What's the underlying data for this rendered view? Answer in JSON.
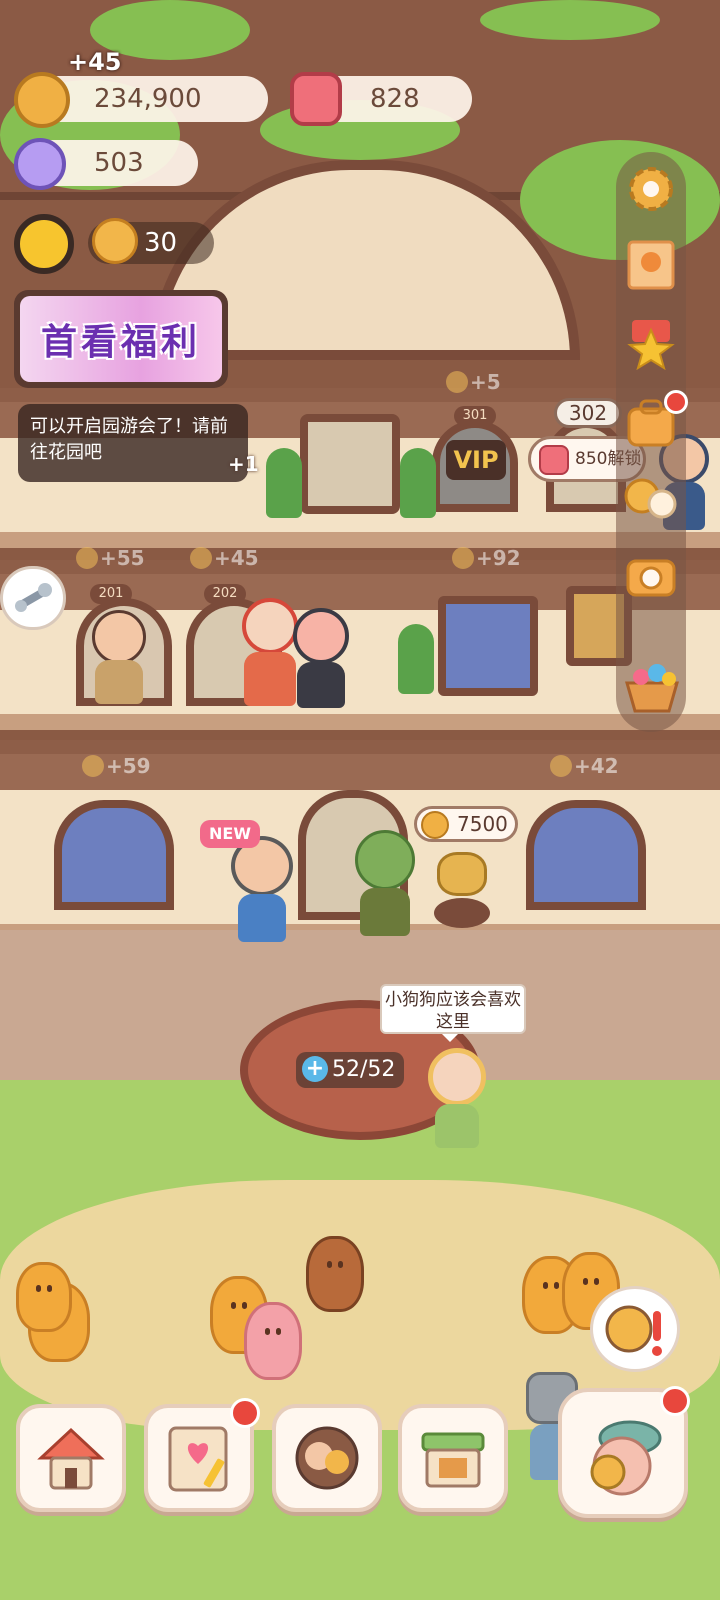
{
  "hud": {
    "coin_gain": "+45",
    "coins": "234,900",
    "gems": "828",
    "crystals": "503",
    "energy": "30"
  },
  "banner": {
    "welfare_label": "首看福利"
  },
  "notice": {
    "message": "可以开启园游会了！请前往花园吧",
    "plus": "+1"
  },
  "rooms": {
    "room_301": "301",
    "room_302": "302",
    "room_201": "201",
    "room_202": "202",
    "vip_label": "VIP",
    "unlock_cost": "850解锁"
  },
  "income_floaters": [
    "+5",
    "+55",
    "+45",
    "+92",
    "+59",
    "+42"
  ],
  "shop": {
    "price": "7500",
    "new_label": "NEW"
  },
  "dialogue": {
    "speech": "小狗狗应该会喜欢这里"
  },
  "well": {
    "counter": "52/52"
  },
  "icons": {
    "coin": "coin-icon",
    "gem": "gem-icon",
    "crystal": "crystal-icon",
    "sun": "sun-icon",
    "settings": "gear-icon",
    "photo_card": "photo-card-icon",
    "star_badge": "star-badge-icon",
    "bag": "bag-icon",
    "friends": "friends-icon",
    "camera": "camera-icon",
    "basket": "basket-icon",
    "tools": "wrench-icon",
    "nav_build": "build-house-icon",
    "nav_notebook": "notebook-icon",
    "nav_characters": "characters-icon",
    "nav_shop": "shop-icon",
    "nav_event": "event-icon"
  },
  "colors": {
    "accent_red": "#e8473d",
    "gold": "#f0b044",
    "wood": "#7a4b3a"
  }
}
